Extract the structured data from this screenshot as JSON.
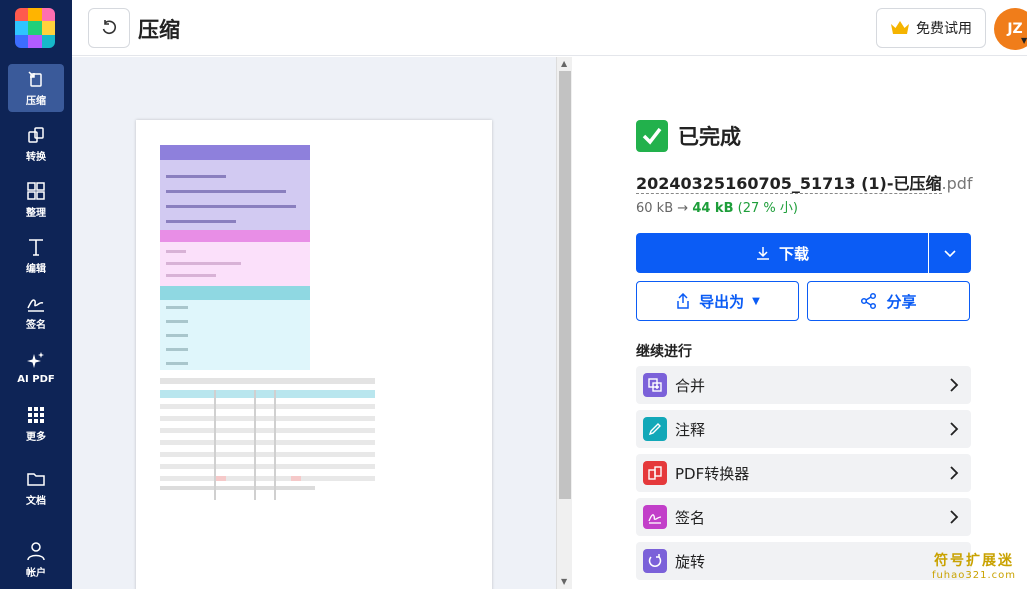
{
  "sidebar": {
    "items": [
      {
        "label": "压缩",
        "icon": "compress-icon",
        "active": true
      },
      {
        "label": "转换",
        "icon": "convert-icon"
      },
      {
        "label": "整理",
        "icon": "organize-icon"
      },
      {
        "label": "编辑",
        "icon": "edit-text-icon"
      },
      {
        "label": "签名",
        "icon": "signature-icon"
      },
      {
        "label": "AI PDF",
        "icon": "sparkle-icon"
      },
      {
        "label": "更多",
        "icon": "grid-dots-icon"
      },
      {
        "label": "文档",
        "icon": "folder-icon"
      },
      {
        "label": "帐户",
        "icon": "user-icon"
      }
    ]
  },
  "header": {
    "title": "压缩",
    "trial_label": "免费试用",
    "avatar_initials": "JZ"
  },
  "result": {
    "status": "已完成",
    "file_name": "20240325160705_51713 (1)-已压缩",
    "file_ext": ".pdf",
    "original_size": "60 kB",
    "arrow": "→",
    "new_size": "44 kB",
    "percent": "(27 % 小)"
  },
  "actions": {
    "download_label": "下载",
    "export_label": "导出为",
    "share_label": "分享"
  },
  "continue": {
    "title": "继续进行",
    "tools": [
      {
        "label": "合并",
        "icon": "merge-icon",
        "color": "#7b61d9"
      },
      {
        "label": "注释",
        "icon": "pencil-icon",
        "color": "#12a8b8"
      },
      {
        "label": "PDF转换器",
        "icon": "convert-icon",
        "color": "#e5393b"
      },
      {
        "label": "签名",
        "icon": "signature-icon",
        "color": "#c23fc9"
      },
      {
        "label": "旋转",
        "icon": "rotate-icon",
        "color": "#7b61d9"
      }
    ]
  },
  "watermark": {
    "line1": "符号扩展迷",
    "line2": "fuhao321.com"
  },
  "colors": {
    "sidebar_bg": "#0e2456",
    "accent": "#0b5cf5",
    "success": "#22b14c",
    "avatar": "#f07d1a"
  }
}
